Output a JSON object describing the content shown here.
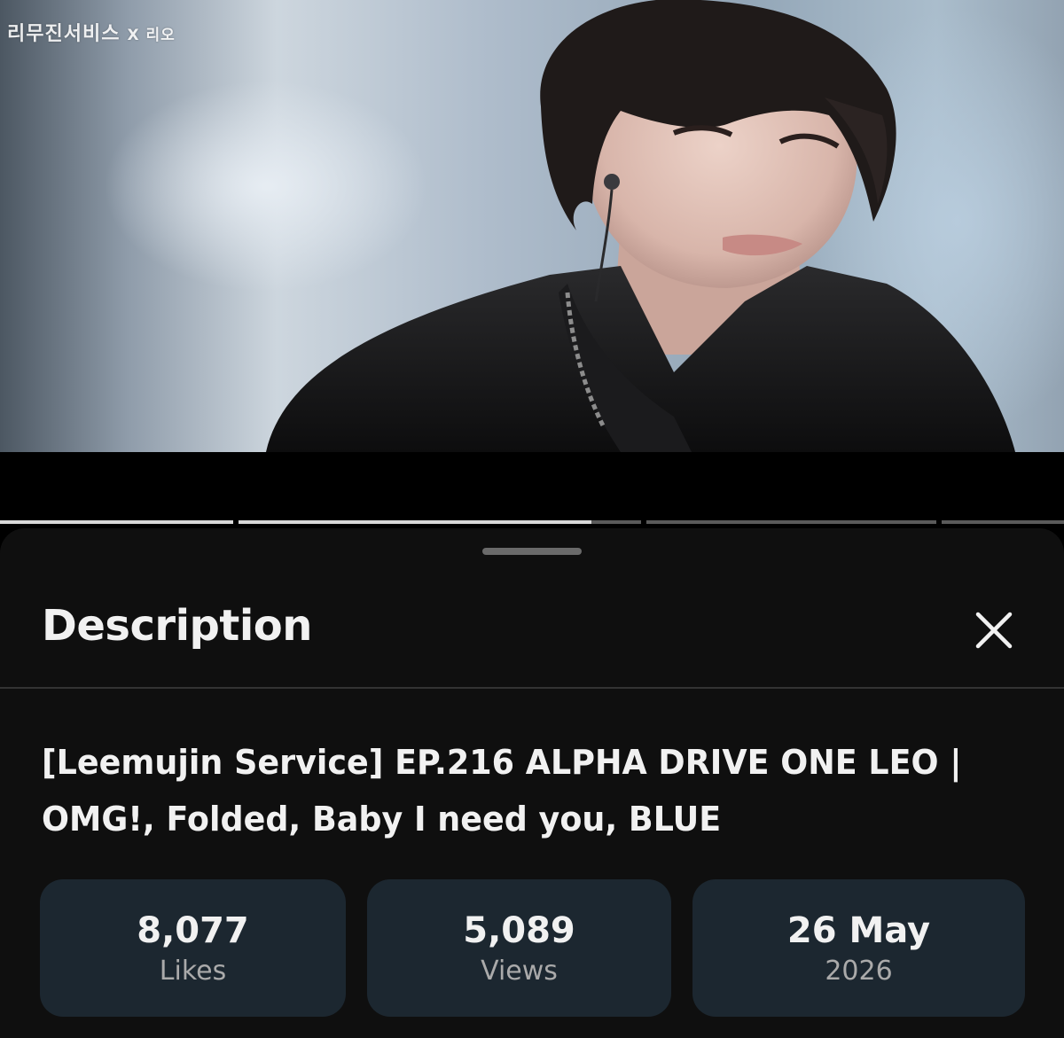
{
  "video": {
    "watermark": "리무진서비스",
    "watermark_sub": "X 리오",
    "progress_segments": [
      {
        "filled": 1.0
      },
      {
        "filled": 1.0
      },
      {
        "filled": 0.0
      },
      {
        "filled": 0.0
      },
      {
        "filled": 0.0
      }
    ]
  },
  "sheet": {
    "title": "Description",
    "close_icon": "close-icon",
    "video_title": "[Leemujin Service] EP.216 ALPHA DRIVE ONE LEO | OMG!, Folded, Baby I need you, BLUE",
    "stats": [
      {
        "value": "8,077",
        "label": "Likes"
      },
      {
        "value": "5,089",
        "label": "Views"
      },
      {
        "value": "26 May",
        "label": "2026"
      }
    ]
  },
  "colors": {
    "sheet_bg": "#0f0f0f",
    "stat_bg": "#1c2730",
    "text_primary": "#f1f1f1",
    "text_secondary": "#aaaaaa"
  }
}
